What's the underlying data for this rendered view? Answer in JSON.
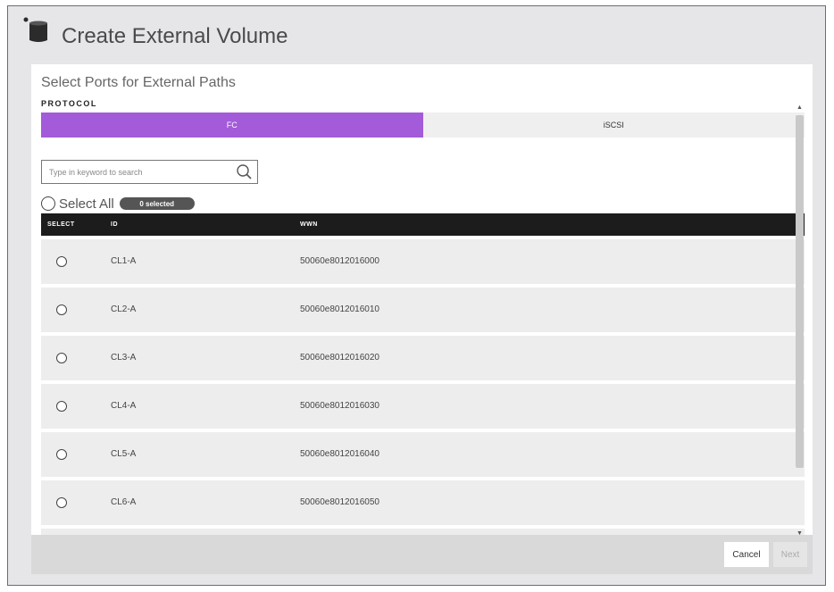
{
  "header": {
    "title": "Create External Volume",
    "icon": "storage-volume-icon"
  },
  "panel": {
    "subtitle": "Select Ports for External Paths",
    "protocol_label": "PROTOCOL",
    "tabs": [
      {
        "label": "FC",
        "active": true
      },
      {
        "label": "iSCSI",
        "active": false
      }
    ],
    "accent_color": "#a35bd9"
  },
  "search": {
    "placeholder": "Type in keyword to search",
    "value": ""
  },
  "select_all": {
    "label": "Select All",
    "badge": "0 selected"
  },
  "table": {
    "columns": [
      "SELECT",
      "ID",
      "WWN"
    ],
    "rows": [
      {
        "id": "CL1-A",
        "wwn": "50060e8012016000"
      },
      {
        "id": "CL2-A",
        "wwn": "50060e8012016010"
      },
      {
        "id": "CL3-A",
        "wwn": "50060e8012016020"
      },
      {
        "id": "CL4-A",
        "wwn": "50060e8012016030"
      },
      {
        "id": "CL5-A",
        "wwn": "50060e8012016040"
      },
      {
        "id": "CL6-A",
        "wwn": "50060e8012016050"
      }
    ]
  },
  "footer": {
    "cancel_label": "Cancel",
    "next_label": "Next"
  }
}
